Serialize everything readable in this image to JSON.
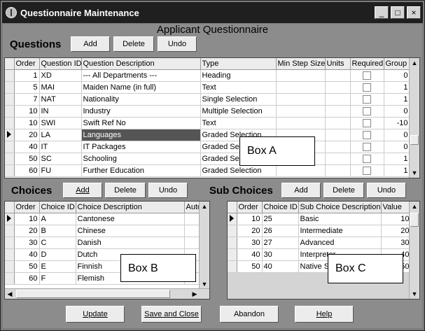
{
  "window": {
    "title": "Questionnaire Maintenance",
    "controls": [
      "_",
      "□",
      "×"
    ]
  },
  "heading": "Applicant Questionnaire",
  "questions": {
    "label": "Questions",
    "buttons": {
      "add": "Add",
      "delete": "Delete",
      "undo": "Undo"
    },
    "columns": [
      "Order",
      "Question ID",
      "Question Description",
      "Type",
      "Min Step Size",
      "Units",
      "Required",
      "Group"
    ],
    "rows": [
      {
        "order": "1",
        "id": "XD",
        "desc": "--- All Departments ---",
        "type": "Heading",
        "min": "",
        "units": "",
        "group": "0"
      },
      {
        "order": "5",
        "id": "MAI",
        "desc": "Maiden Name (in full)",
        "type": "Text",
        "min": "",
        "units": "",
        "group": "1"
      },
      {
        "order": "7",
        "id": "NAT",
        "desc": "Nationality",
        "type": "Single Selection",
        "min": "",
        "units": "",
        "group": "1"
      },
      {
        "order": "10",
        "id": "IN",
        "desc": "Industry",
        "type": "Multiple Selection",
        "min": "",
        "units": "",
        "group": "0"
      },
      {
        "order": "10",
        "id": "SWI",
        "desc": "Swift Ref No",
        "type": "Text",
        "min": "",
        "units": "",
        "group": "-10"
      },
      {
        "order": "20",
        "id": "LA",
        "desc": "Languages",
        "type": "Graded Selection",
        "min": "",
        "units": "",
        "group": "0"
      },
      {
        "order": "40",
        "id": "IT",
        "desc": "IT Packages",
        "type": "Graded Selection",
        "min": "",
        "units": "",
        "group": "0"
      },
      {
        "order": "50",
        "id": "SC",
        "desc": "Schooling",
        "type": "Graded Selection",
        "min": "",
        "units": "",
        "group": "1"
      },
      {
        "order": "60",
        "id": "FU",
        "desc": "Further Education",
        "type": "Graded Selection",
        "min": "",
        "units": "",
        "group": "1"
      }
    ]
  },
  "choices": {
    "label": "Choices",
    "buttons": {
      "add": "Add",
      "delete": "Delete",
      "undo": "Undo"
    },
    "columns": [
      "Order",
      "Choice ID",
      "Choice Description",
      "Autofill"
    ],
    "rows": [
      {
        "order": "10",
        "id": "A",
        "desc": "Cantonese"
      },
      {
        "order": "20",
        "id": "B",
        "desc": "Chinese"
      },
      {
        "order": "30",
        "id": "C",
        "desc": "Danish"
      },
      {
        "order": "40",
        "id": "D",
        "desc": "Dutch"
      },
      {
        "order": "50",
        "id": "E",
        "desc": "Finnish"
      },
      {
        "order": "60",
        "id": "F",
        "desc": "Flemish"
      }
    ]
  },
  "subchoices": {
    "label": "Sub Choices",
    "buttons": {
      "add": "Add",
      "delete": "Delete",
      "undo": "Undo"
    },
    "columns": [
      "Order",
      "Choice ID",
      "Sub Choice Description",
      "Value"
    ],
    "rows": [
      {
        "order": "10",
        "id": "25",
        "desc": "Basic",
        "value": "10"
      },
      {
        "order": "20",
        "id": "26",
        "desc": "Intermediate",
        "value": "20"
      },
      {
        "order": "30",
        "id": "27",
        "desc": "Advanced",
        "value": "30"
      },
      {
        "order": "40",
        "id": "30",
        "desc": "Interpreter",
        "value": "40"
      },
      {
        "order": "50",
        "id": "40",
        "desc": "Native Speaker",
        "value": "50"
      }
    ]
  },
  "annotations": {
    "a": "Box A",
    "b": "Box B",
    "c": "Box C"
  },
  "footer": {
    "update": "Update",
    "save_close": "Save and Close",
    "abandon": "Abandon",
    "help": "Help"
  },
  "scroll": {
    "up": "▲",
    "down": "▼",
    "left": "◀",
    "right": "▶"
  }
}
